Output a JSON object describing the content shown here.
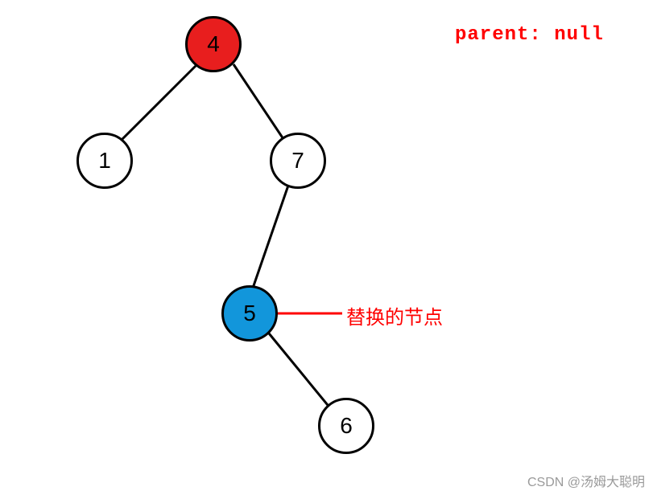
{
  "parent_label": "parent: null",
  "replace_label": "替换的节点",
  "watermark": "CSDN @汤姆大聪明",
  "nodes": {
    "root": {
      "value": "4",
      "color": "red"
    },
    "left": {
      "value": "1",
      "color": "white"
    },
    "right": {
      "value": "7",
      "color": "white"
    },
    "mid": {
      "value": "5",
      "color": "blue"
    },
    "bottom": {
      "value": "6",
      "color": "white"
    }
  },
  "chart_data": {
    "type": "diagram",
    "title": "Binary search tree node replacement illustration",
    "tree": {
      "value": 4,
      "highlight": "red (node being deleted / root, parent is null)",
      "left": {
        "value": 1
      },
      "right": {
        "value": 7,
        "left": {
          "value": 5,
          "highlight": "blue (replacement node / in-order successor)",
          "right": {
            "value": 6
          }
        }
      }
    },
    "annotations": [
      {
        "text": "parent: null",
        "refers_to": 4
      },
      {
        "text": "替换的节点",
        "translation_en": "replacement node",
        "refers_to": 5
      }
    ]
  }
}
